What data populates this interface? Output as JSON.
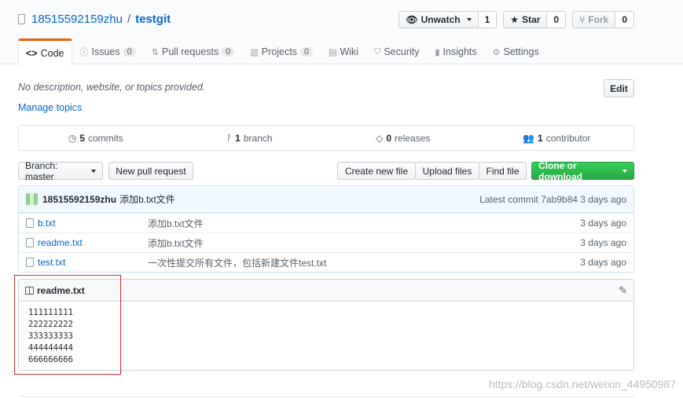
{
  "repo": {
    "owner": "18515592159zhu",
    "separator": "/",
    "name": "testgit"
  },
  "actions": {
    "watch_label": "Unwatch",
    "watch_count": "1",
    "star_label": "Star",
    "star_count": "0",
    "fork_label": "Fork",
    "fork_count": "0"
  },
  "tabs": [
    {
      "label": "Code",
      "icon": "code-icon"
    },
    {
      "label": "Issues",
      "count": "0",
      "icon": "issue-icon"
    },
    {
      "label": "Pull requests",
      "count": "0",
      "icon": "pull-request-icon"
    },
    {
      "label": "Projects",
      "count": "0",
      "icon": "project-icon"
    },
    {
      "label": "Wiki",
      "icon": "book-icon"
    },
    {
      "label": "Security",
      "icon": "shield-icon"
    },
    {
      "label": "Insights",
      "icon": "graph-icon"
    },
    {
      "label": "Settings",
      "icon": "gear-icon"
    }
  ],
  "description": "No description, website, or topics provided.",
  "manage_topics": "Manage topics",
  "edit_label": "Edit",
  "summary": {
    "commits_num": "5",
    "commits_label": "commits",
    "branch_num": "1",
    "branch_label": "branch",
    "releases_num": "0",
    "releases_label": "releases",
    "contrib_num": "1",
    "contrib_label": "contributor"
  },
  "filenav": {
    "branch_label": "Branch: master",
    "new_pr": "New pull request",
    "create_file": "Create new file",
    "upload_files": "Upload files",
    "find_file": "Find file",
    "clone": "Clone or download"
  },
  "commit": {
    "author": "18515592159zhu",
    "message": "添加b.txt文件",
    "latest_label": "Latest commit",
    "sha": "7ab9b84",
    "age": "3 days ago"
  },
  "files": [
    {
      "name": "b.txt",
      "message": "添加b.txt文件",
      "age": "3 days ago"
    },
    {
      "name": "readme.txt",
      "message": "添加b.txt文件",
      "age": "3 days ago"
    },
    {
      "name": "test.txt",
      "message": "一次性提交所有文件，包括新建文件test.txt",
      "age": "3 days ago"
    }
  ],
  "readme": {
    "title": "readme.txt",
    "lines": [
      "111111111",
      "222222222",
      "333333333",
      "444444444",
      "666666666"
    ]
  },
  "watermark": "https://blog.csdn.net/weixin_44950987",
  "colors": {
    "link": "#0366d6",
    "accent_tab": "#e36209",
    "clone_green": "#28a745",
    "highlight_box": "#d32f2f"
  }
}
